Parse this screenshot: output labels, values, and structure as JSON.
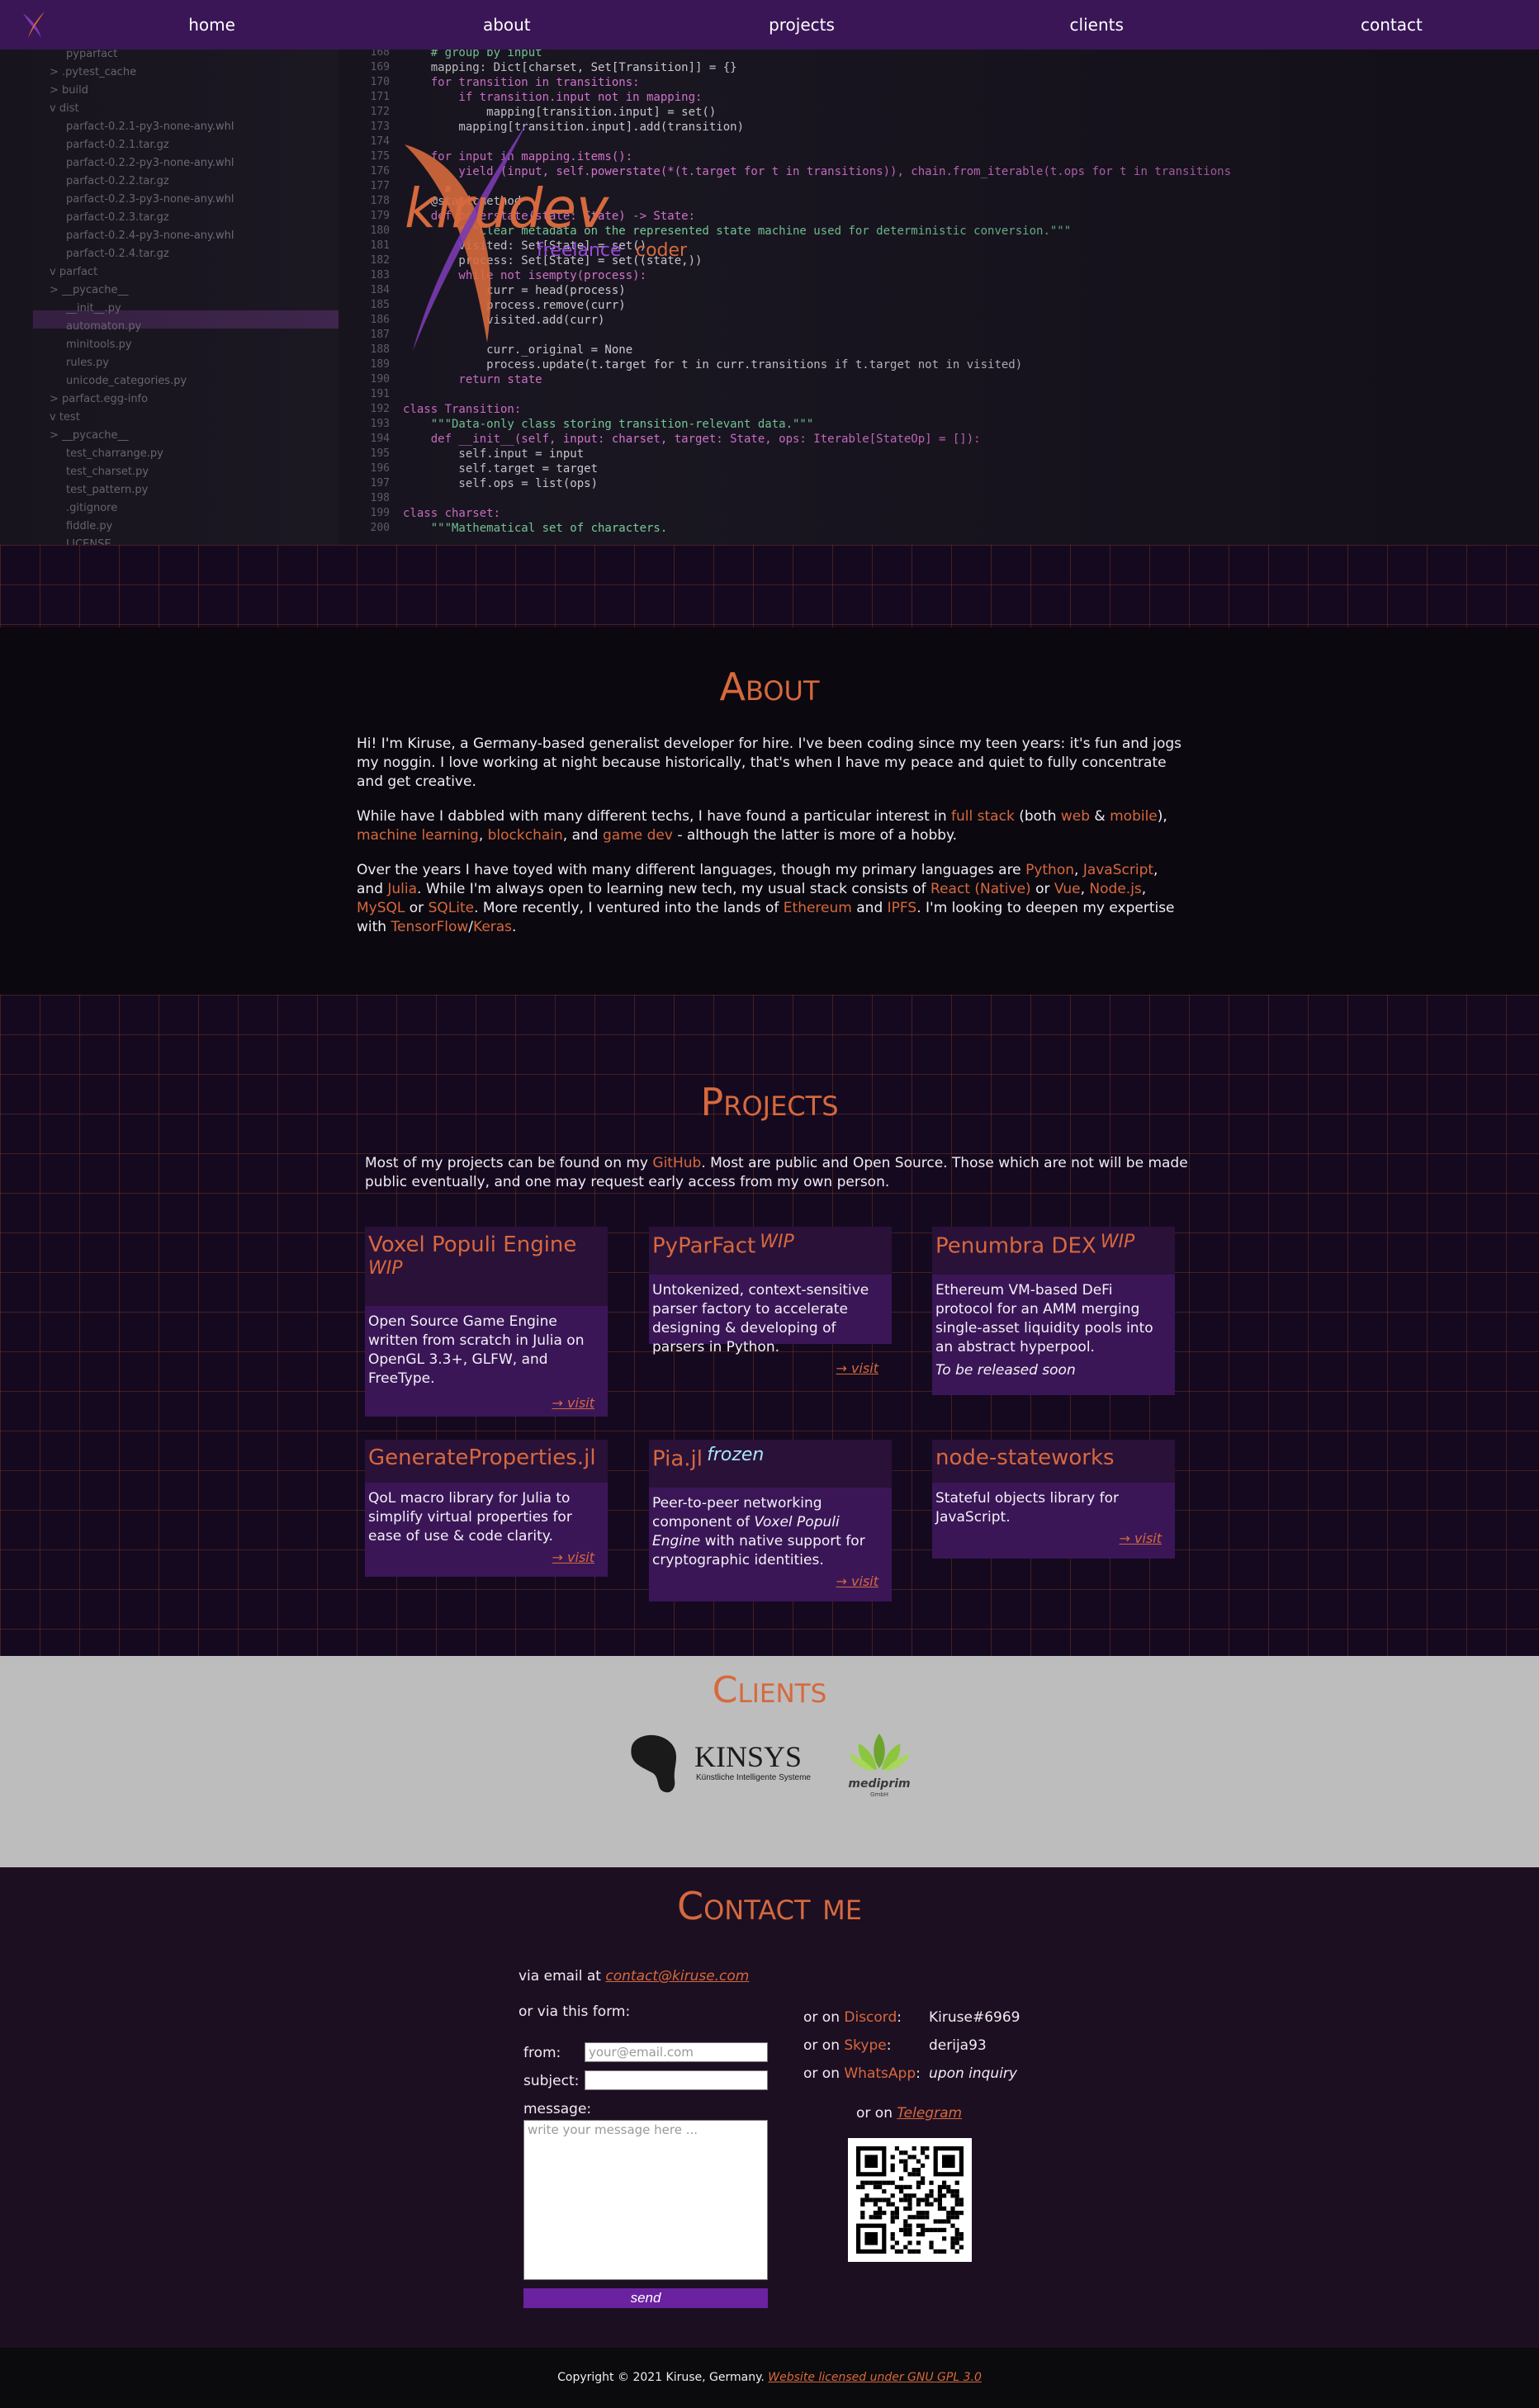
{
  "nav": {
    "links": [
      "home",
      "about",
      "projects",
      "clients",
      "contact"
    ]
  },
  "hero": {
    "brand_name": "kirudev",
    "brand_sub1": "freelance",
    "brand_sub2": "coder",
    "file_tree": [
      "pyparfact",
      "> .pytest_cache",
      "> build",
      "v dist",
      "parfact-0.2.1-py3-none-any.whl",
      "parfact-0.2.1.tar.gz",
      "parfact-0.2.2-py3-none-any.whl",
      "parfact-0.2.2.tar.gz",
      "parfact-0.2.3-py3-none-any.whl",
      "parfact-0.2.3.tar.gz",
      "parfact-0.2.4-py3-none-any.whl",
      "parfact-0.2.4.tar.gz",
      "v parfact",
      "> __pycache__",
      "__init__.py",
      "automaton.py",
      "minitools.py",
      "rules.py",
      "unicode_categories.py",
      "> parfact.egg-info",
      "v test",
      "> __pycache__",
      "test_charrange.py",
      "test_charset.py",
      "test_pattern.py",
      ".gitignore",
      "fiddle.py",
      "LICENSE"
    ],
    "line_numbers": [
      "168",
      "169",
      "170",
      "171",
      "172",
      "173",
      "174",
      "175",
      "176",
      "177",
      "178",
      "179",
      "180",
      "181",
      "182",
      "183",
      "184",
      "185",
      "186",
      "187",
      "188",
      "189",
      "190",
      "191",
      "192",
      "193",
      "194",
      "195",
      "196",
      "197",
      "198",
      "199",
      "200"
    ],
    "code_lines": [
      "    # group by input",
      "    mapping: Dict[charset, Set[Transition]] = {}",
      "    for transition in transitions:",
      "        if transition.input not in mapping:",
      "            mapping[transition.input] = set()",
      "        mapping[transition.input].add(transition)",
      "",
      "    for input in mapping.items():",
      "        yield (input, self.powerstate(*(t.target for t in transitions)), chain.from_iterable(t.ops for t in transitions",
      "",
      "    @staticmethod",
      "    def powerstate(state: State) -> State:",
      "        \"\"\"Clear metadata on the represented state machine used for deterministic conversion.\"\"\"",
      "        visited: Set[State] = set()",
      "        process: Set[State] = set((state,))",
      "        while not isempty(process):",
      "            curr = head(process)",
      "            process.remove(curr)",
      "            visited.add(curr)",
      "",
      "            curr._original = None",
      "            process.update(t.target for t in curr.transitions if t.target not in visited)",
      "        return state",
      "",
      "class Transition:",
      "    \"\"\"Data-only class storing transition-relevant data.\"\"\"",
      "    def __init__(self, input: charset, target: State, ops: Iterable[StateOp] = []):",
      "        self.input = input",
      "        self.target = target",
      "        self.ops = list(ops)",
      "",
      "class charset:",
      "    \"\"\"Mathematical set of characters."
    ]
  },
  "about": {
    "title": "About",
    "p1": "Hi! I'm Kiruse, a Germany-based generalist developer for hire. I've been coding since my teen years: it's fun and jogs my noggin. I love working at night because historically, that's when I have my peace and quiet to fully concentrate and get creative.",
    "p2": [
      {
        "t": "While have I dabbled with many different techs, I have found a particular interest in ",
        "a": false
      },
      {
        "t": "full stack",
        "a": true
      },
      {
        "t": " (both ",
        "a": false
      },
      {
        "t": "web",
        "a": true
      },
      {
        "t": " & ",
        "a": false
      },
      {
        "t": "mobile",
        "a": true
      },
      {
        "t": "), ",
        "a": false
      },
      {
        "t": "machine learning",
        "a": true
      },
      {
        "t": ", ",
        "a": false
      },
      {
        "t": "blockchain",
        "a": true
      },
      {
        "t": ", and ",
        "a": false
      },
      {
        "t": "game dev",
        "a": true
      },
      {
        "t": " - although the latter is more of a hobby.",
        "a": false
      }
    ],
    "p3": [
      {
        "t": "Over the years I have toyed with many different languages, though my primary languages are ",
        "a": false
      },
      {
        "t": "Python",
        "a": true
      },
      {
        "t": ", ",
        "a": false
      },
      {
        "t": "JavaScript",
        "a": true
      },
      {
        "t": ", and ",
        "a": false
      },
      {
        "t": "Julia",
        "a": true
      },
      {
        "t": ". While I'm always open to learning new tech, my usual stack consists of ",
        "a": false
      },
      {
        "t": "React (Native)",
        "a": true
      },
      {
        "t": " or ",
        "a": false
      },
      {
        "t": "Vue",
        "a": true
      },
      {
        "t": ", ",
        "a": false
      },
      {
        "t": "Node.js",
        "a": true
      },
      {
        "t": ", ",
        "a": false
      },
      {
        "t": "MySQL",
        "a": true
      },
      {
        "t": " or ",
        "a": false
      },
      {
        "t": "SQLite",
        "a": true
      },
      {
        "t": ". More recently, I ventured into the lands of ",
        "a": false
      },
      {
        "t": "Ethereum",
        "a": true
      },
      {
        "t": " and ",
        "a": false
      },
      {
        "t": "IPFS",
        "a": true
      },
      {
        "t": ". I'm looking to deepen my expertise with ",
        "a": false
      },
      {
        "t": "TensorFlow",
        "a": true
      },
      {
        "t": "/",
        "a": false
      },
      {
        "t": "Keras",
        "a": true
      },
      {
        "t": ".",
        "a": false
      }
    ]
  },
  "projects": {
    "title": "Projects",
    "intro_before": "Most of my projects can be found on my ",
    "intro_link": "GitHub",
    "intro_after": ". Most are public and Open Source. Those which are not will be made public eventually, and one may request early access from my own person.",
    "visit_label": "→ visit",
    "cards": [
      {
        "title": "Voxel Populi Engine",
        "tag": "WIP",
        "desc": "Open Source Game Engine written from scratch in Julia on OpenGL 3.3+, GLFW, and FreeType.",
        "note": ""
      },
      {
        "title": "PyParFact",
        "tag": "WIP",
        "desc": "Untokenized, context-sensitive parser factory to accelerate designing & developing of parsers in Python.",
        "note": ""
      },
      {
        "title": "Penumbra DEX",
        "tag": "WIP",
        "desc": "Ethereum VM-based DeFi protocol for an AMM merging single-asset liquidity pools into an abstract hyperpool.",
        "note": "To be released soon"
      },
      {
        "title": "GenerateProperties.jl",
        "tag": "",
        "desc": "QoL macro library for Julia to simplify virtual properties for ease of use & code clarity.",
        "note": ""
      },
      {
        "title": "Pia.jl",
        "tag": "frozen",
        "desc_before": "Peer-to-peer networking component of ",
        "desc_em": "Voxel Populi Engine",
        "desc_after": " with native support for cryptographic identities.",
        "note": ""
      },
      {
        "title": "node-stateworks",
        "tag": "",
        "desc": "Stateful objects library for JavaScript.",
        "note": ""
      }
    ]
  },
  "clients": {
    "title": "Clients",
    "kinsys_name": "KINSYS",
    "kinsys_sub": "Künstliche Intelligente Systeme",
    "mediprim_name": "mediprim",
    "mediprim_sub": "GmbH"
  },
  "contact": {
    "title": "Contact me",
    "via_email": "via email at ",
    "email": "contact@kiruse.com",
    "via_form": "or via this form:",
    "from_label": "from:",
    "from_placeholder": "your@email.com",
    "subject_label": "subject:",
    "message_label": "message:",
    "message_placeholder": "write your message here ...",
    "send_label": "send",
    "or_on": "or on ",
    "discord_label": "Discord",
    "discord_value": "Kiruse#6969",
    "skype_label": "Skype",
    "skype_value": "derija93",
    "whatsapp_label": "WhatsApp",
    "whatsapp_value": "upon inquiry",
    "telegram_label": "Telegram"
  },
  "footer": {
    "copyright": "Copyright © 2021 Kiruse, Germany. ",
    "license_link": "Website licensed under GNU GPL 3.0"
  },
  "colors": {
    "accent": "#d6693d",
    "nav": "#3a1657",
    "card": "#3a1657",
    "button": "#6a22a0"
  }
}
